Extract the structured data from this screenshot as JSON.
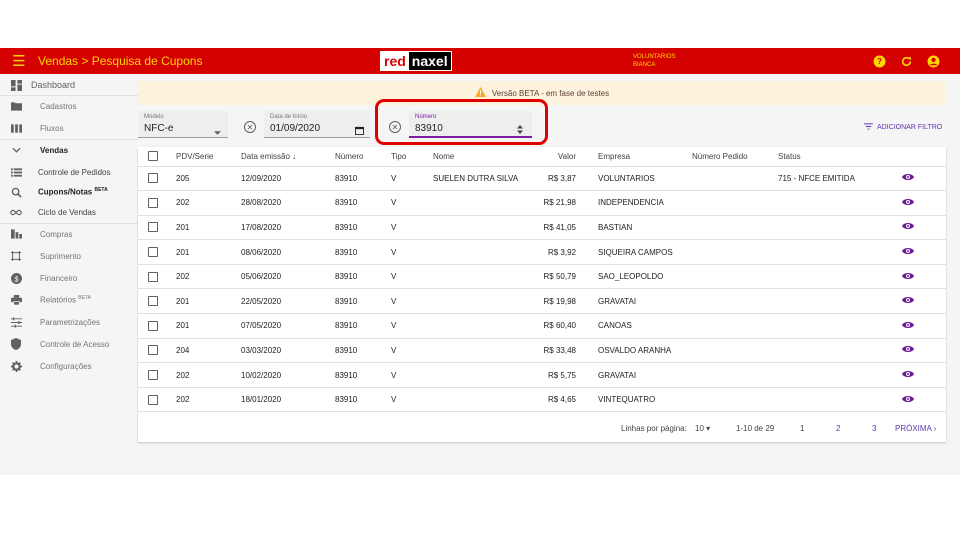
{
  "header": {
    "title": "Vendas > Pesquisa de Cupons",
    "logo_red": "red",
    "logo_naxel": "naxel",
    "user_line1": "VOLUNTARIOS",
    "user_line2": "BIANCA",
    "bg_color": "#d50000",
    "accent_color": "#ffd600"
  },
  "sidebar": {
    "items": [
      {
        "label": "Dashboard",
        "icon": "dashboard-icon"
      },
      {
        "label": "Cadastros",
        "icon": "folder-icon"
      },
      {
        "label": "Fluxos",
        "icon": "columns-icon"
      },
      {
        "label": "Vendas",
        "icon": "chevron-down-icon"
      },
      {
        "label": "Controle de Pedidos",
        "icon": "list-icon"
      },
      {
        "label": "Cupons/Notas",
        "sup": "BETA",
        "icon": "receipt-search-icon"
      },
      {
        "label": "Ciclo de Vendas",
        "icon": "infinity-icon"
      },
      {
        "label": "Compras",
        "icon": "compras-icon"
      },
      {
        "label": "Suprimento",
        "icon": "crop-icon"
      },
      {
        "label": "Financeiro",
        "icon": "money-icon"
      },
      {
        "label": "Relatórios",
        "sup": "BETA",
        "icon": "printer-icon"
      },
      {
        "label": "Parametrizações",
        "icon": "tune-icon"
      },
      {
        "label": "Controle de Acesso",
        "icon": "shield-icon"
      },
      {
        "label": "Configurações",
        "icon": "gear-icon"
      }
    ]
  },
  "banner": {
    "text": "Versão BETA - em fase de testes"
  },
  "filters": {
    "modelo": {
      "label": "Modelo",
      "value": "NFC-e"
    },
    "data_inicio": {
      "label": "Data de Início",
      "value": "01/09/2020"
    },
    "numero": {
      "label": "Número",
      "value": "83910"
    },
    "add_filter": "ADICIONAR FILTRO"
  },
  "table": {
    "headers": [
      "PDV/Serie",
      "Data emissão",
      "Número",
      "Tipo",
      "Nome",
      "Valor",
      "Empresa",
      "Número Pedido",
      "Status"
    ],
    "rows": [
      [
        "205",
        "12/09/2020",
        "83910",
        "V",
        "SUELEN DUTRA SILVA",
        "R$ 3,87",
        "VOLUNTARIOS",
        "",
        "715 - NFCE EMITIDA"
      ],
      [
        "202",
        "28/08/2020",
        "83910",
        "V",
        "",
        "R$ 21,98",
        "INDEPENDENCIA",
        "",
        ""
      ],
      [
        "201",
        "17/08/2020",
        "83910",
        "V",
        "",
        "R$ 41,05",
        "BASTIAN",
        "",
        ""
      ],
      [
        "201",
        "08/06/2020",
        "83910",
        "V",
        "",
        "R$ 3,92",
        "SIQUEIRA CAMPOS",
        "",
        ""
      ],
      [
        "202",
        "05/06/2020",
        "83910",
        "V",
        "",
        "R$ 50,79",
        "SAO_LEOPOLDO",
        "",
        ""
      ],
      [
        "201",
        "22/05/2020",
        "83910",
        "V",
        "",
        "R$ 19,98",
        "GRAVATAI",
        "",
        ""
      ],
      [
        "201",
        "07/05/2020",
        "83910",
        "V",
        "",
        "R$ 60,40",
        "CANOAS",
        "",
        ""
      ],
      [
        "204",
        "03/03/2020",
        "83910",
        "V",
        "",
        "R$ 33,48",
        "OSVALDO ARANHA",
        "",
        ""
      ],
      [
        "202",
        "10/02/2020",
        "83910",
        "V",
        "",
        "R$ 5,75",
        "GRAVATAI",
        "",
        ""
      ],
      [
        "202",
        "18/01/2020",
        "83910",
        "V",
        "",
        "R$ 4,65",
        "VINTEQUATRO",
        "",
        ""
      ]
    ]
  },
  "pagination": {
    "rows_label": "Linhas por página:",
    "rows_value": "10",
    "range": "1-10 de 29",
    "pages": [
      "1",
      "2",
      "3"
    ],
    "next": "PRÓXIMA"
  }
}
